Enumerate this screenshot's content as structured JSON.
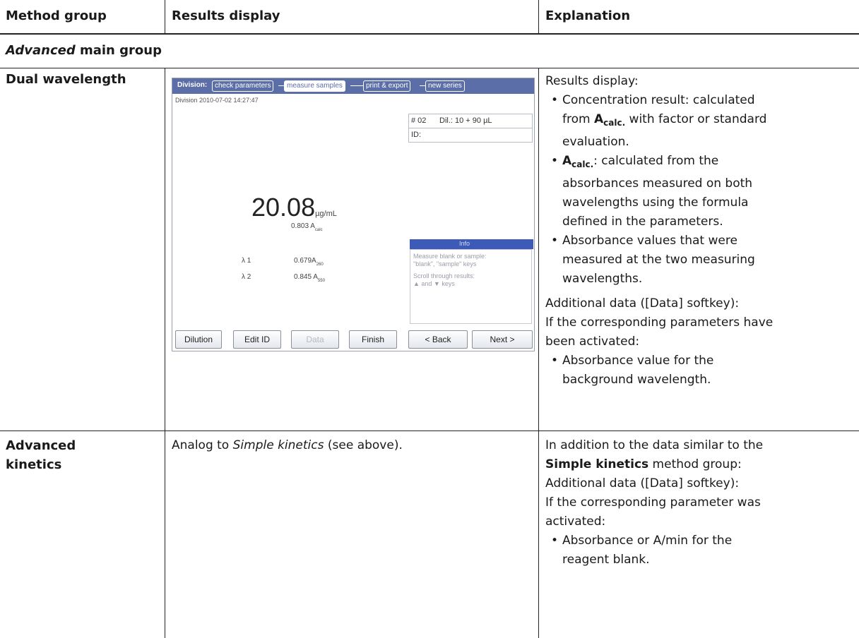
{
  "headers": {
    "method_group": "Method group",
    "results_display": "Results display",
    "explanation": "Explanation"
  },
  "section": {
    "italic": "Advanced",
    "rest": " main group"
  },
  "rows": {
    "dual": {
      "method": "Dual wavelength",
      "explanation": {
        "intro": "Results display:",
        "b1_line1": "Concentration result: calculated",
        "b1_line2_pre": "from ",
        "b1_a": "A",
        "b1_sub": "calc.",
        "b1_line2_post": " with factor or standard",
        "b1_line3": "evaluation.",
        "b2_a": "A",
        "b2_sub": "calc.",
        "b2_line1_post": ": calculated from the",
        "b2_line2": "absorbances measured on both",
        "b2_line3": "wavelengths using the formula",
        "b2_line4": "defined in the parameters.",
        "b3_line1": "Absorbance values that were",
        "b3_line2": "measured at the two measuring",
        "b3_line3": "wavelengths.",
        "extra1": "Additional data ([Data] softkey):",
        "extra2": "If the corresponding parameters have",
        "extra3": "been activated:",
        "b4_line1": "Absorbance value for the",
        "b4_line2": "background wavelength."
      }
    },
    "kinetics": {
      "method_line1": "Advanced",
      "method_line2": "kinetics",
      "results_pre": "Analog to ",
      "results_italic": "Simple kinetics",
      "results_post": " (see above).",
      "explanation": {
        "line1": "In addition to the data similar to the",
        "line2_bold": "Simple kinetics",
        "line2_rest": " method group:",
        "line3": "Additional data ([Data] softkey):",
        "line4": "If the corresponding parameter was",
        "line5": "activated:",
        "b1_line1": "Absorbance or A/min for the",
        "b1_line2": "reagent blank."
      }
    }
  },
  "device": {
    "steps": {
      "label": "Division:",
      "check": "check parameters",
      "measure": "measure samples",
      "print": "print & export",
      "new": "new series"
    },
    "timestamp": "Division 2010-07-02 14:27:47",
    "sample_no": "# 02",
    "dilution": "Dil.: 10 + 90 µL",
    "id_label": "ID:",
    "result_value": "20.08",
    "result_unit": "µg/mL",
    "acalc_value": "0.803 A",
    "acalc_sub": "calc",
    "lambda1_label": "λ 1",
    "lambda1_value": "0.679A",
    "lambda1_sub": "260",
    "lambda2_label": "λ 2",
    "lambda2_value": "0.845 A",
    "lambda2_sub": "550",
    "info_title": "Info",
    "info_line1": "Measure blank or sample:",
    "info_line2": "\"blank\", \"sample\" keys",
    "info_line3": "Scroll through results:",
    "info_line4": "▲ and ▼ keys",
    "buttons": {
      "dilution": "Dilution",
      "edit_id": "Edit ID",
      "data": "Data",
      "finish": "Finish",
      "back": "< Back",
      "next": "Next >"
    }
  }
}
